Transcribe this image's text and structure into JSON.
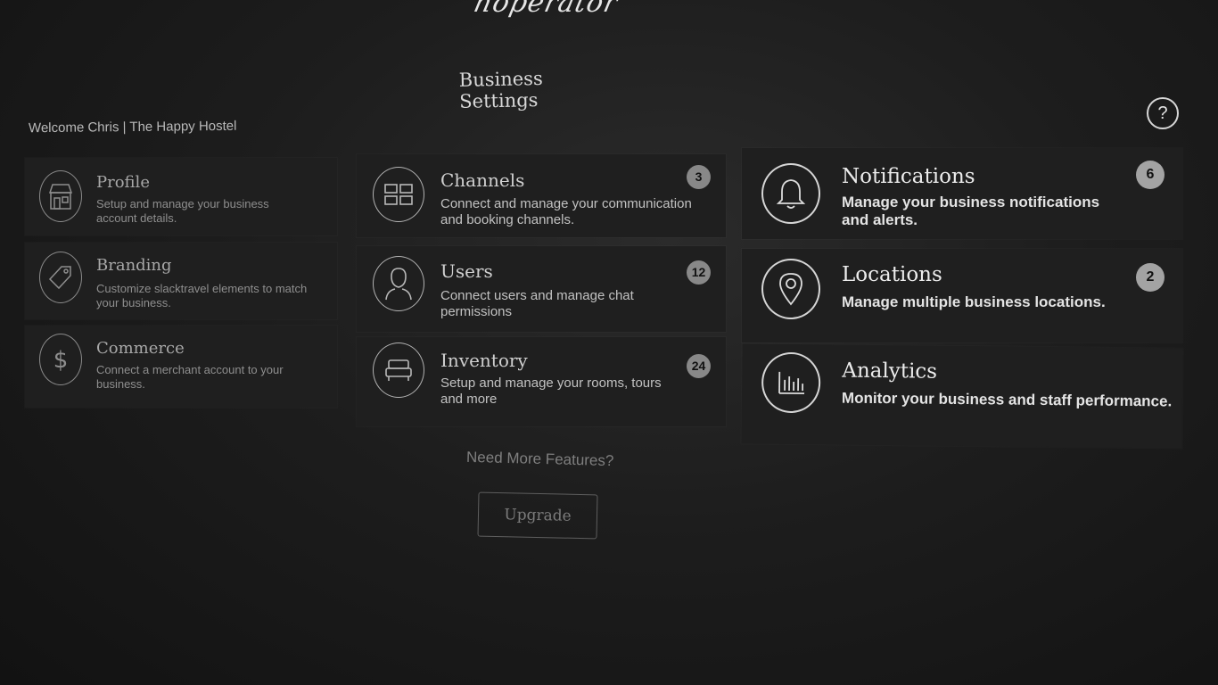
{
  "brand": {
    "logo_text": "hoperator"
  },
  "header": {
    "title": "Business Settings",
    "welcome": "Welcome Chris | The Happy Hostel",
    "help_label": "?"
  },
  "cards": {
    "profile": {
      "title": "Profile",
      "desc": "Setup and manage your business account details.",
      "icon": "storefront-icon"
    },
    "branding": {
      "title": "Branding",
      "desc": "Customize slacktravel elements to match your business.",
      "icon": "tag-icon"
    },
    "commerce": {
      "title": "Commerce",
      "desc": "Connect a merchant account to your business.",
      "icon": "dollar-icon"
    },
    "channels": {
      "title": "Channels",
      "desc": "Connect and manage your communication and booking channels.",
      "badge": "3",
      "icon": "grid-icon"
    },
    "users": {
      "title": "Users",
      "desc": "Connect users and manage chat permissions",
      "badge": "12",
      "icon": "user-icon"
    },
    "inventory": {
      "title": "Inventory",
      "desc": "Setup and manage your rooms, tours and more",
      "badge": "24",
      "icon": "bed-icon"
    },
    "notifications": {
      "title": "Notifications",
      "desc": "Manage your business notifications and alerts.",
      "badge": "6",
      "icon": "bell-icon"
    },
    "locations": {
      "title": "Locations",
      "desc": "Manage multiple business locations.",
      "badge": "2",
      "icon": "map-pin-icon"
    },
    "analytics": {
      "title": "Analytics",
      "desc": "Monitor your business and staff performance.",
      "icon": "bar-chart-icon"
    }
  },
  "footer": {
    "prompt": "Need More Features?",
    "upgrade_label": "Upgrade"
  }
}
